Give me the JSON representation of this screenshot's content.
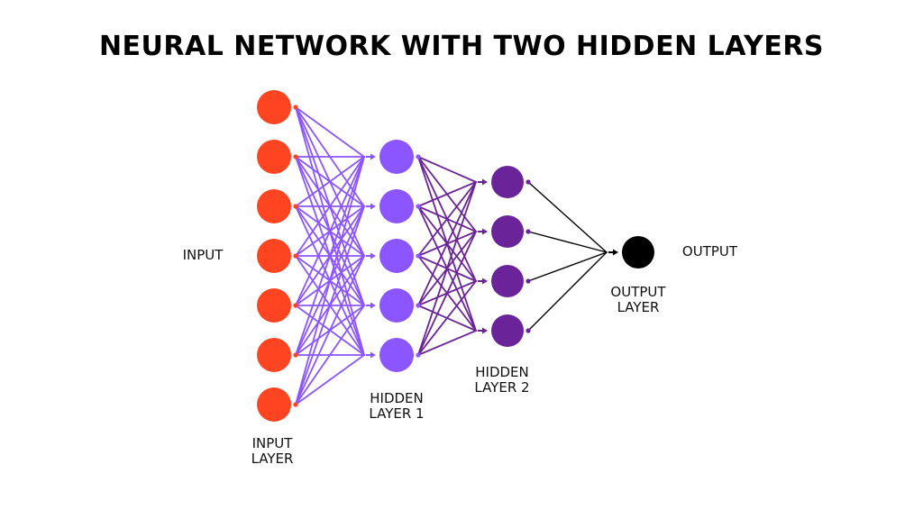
{
  "title": "NEURAL NETWORK WITH TWO HIDDEN LAYERS",
  "labels": {
    "input": "INPUT",
    "output": "OUTPUT",
    "input_layer": [
      "INPUT",
      "LAYER"
    ],
    "hidden_layer_1": [
      "HIDDEN",
      "LAYER 1"
    ],
    "hidden_layer_2": [
      "HIDDEN",
      "LAYER 2"
    ],
    "output_layer": [
      "OUTPUT",
      "LAYER"
    ]
  },
  "layers": [
    {
      "name": "input-layer",
      "nodes": 7,
      "color": "#ff4422",
      "edge_color": "#8b55ff"
    },
    {
      "name": "hidden-layer-1",
      "nodes": 5,
      "color": "#8b55ff",
      "edge_color": "#6a2399"
    },
    {
      "name": "hidden-layer-2",
      "nodes": 4,
      "color": "#6a2399",
      "edge_color": "#000000"
    },
    {
      "name": "output-layer",
      "nodes": 1,
      "color": "#000000"
    }
  ]
}
